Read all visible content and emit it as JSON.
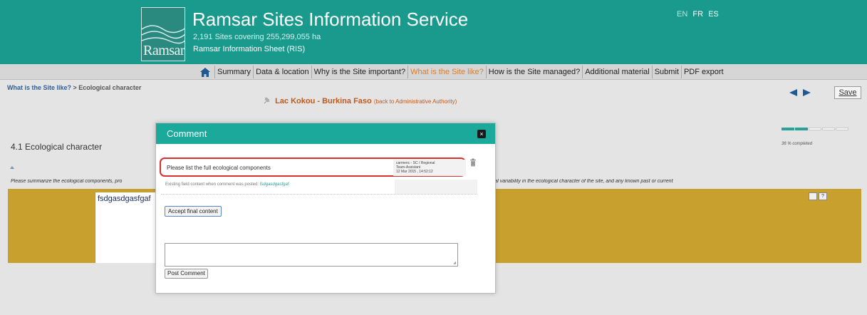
{
  "header": {
    "logo_text": "Ramsar",
    "title": "Ramsar Sites Information Service",
    "subtitle": "2,191 Sites covering 255,299,055 ha",
    "subtitle2": "Ramsar Information Sheet (RIS)",
    "languages": [
      "EN",
      "FR",
      "ES"
    ],
    "active_language": "EN"
  },
  "nav": {
    "home_icon": "home-icon",
    "items": [
      {
        "label": "Summary"
      },
      {
        "label": "Data & location"
      },
      {
        "label": "Why is the Site important?"
      },
      {
        "label": "What is the Site like?",
        "active": true
      },
      {
        "label": "How is the Site managed?"
      },
      {
        "label": "Additional material"
      },
      {
        "label": "Submit"
      },
      {
        "label": "PDF export"
      }
    ]
  },
  "breadcrumb": {
    "link": "What is the Site like?",
    "sep": " > ",
    "current": "Ecological character"
  },
  "site": {
    "name": "Lac Kokou - Burkina Faso",
    "back_link": "(back to Administrative Authority)"
  },
  "toolbar": {
    "save_label": "Save"
  },
  "progress": {
    "fraction": 0.36,
    "segments_total": 5,
    "segments_done": 2,
    "text": "36 % completed"
  },
  "section": {
    "title": "4.1 Ecological character",
    "instruction_left": "Please summarize the ecological components, pro",
    "instruction_right": "ral variability in the ecological character of the site, and any known past or current",
    "field_value": "fsdgasdgasfgaf",
    "tool_expand": "",
    "tool_help": "?"
  },
  "modal": {
    "title": "Comment",
    "close_label": "×",
    "comment_text": "Please list the full ecological components",
    "comment_author": "carmenc - SC / Regional",
    "comment_role": "Team-Assistant",
    "comment_date": "12 Mar 2015 , 14:52:12",
    "existing_label": "Existing field content when comment was posted:",
    "existing_value": "fsdgasdgasfgaf",
    "accept_label": "Accept final content",
    "new_comment_value": "",
    "post_label": "Post Comment"
  },
  "colors": {
    "header_teal": "#1a9a8c",
    "modal_teal": "#1aa99a",
    "field_gold": "#c8a02e",
    "active_nav": "#e27a25",
    "highlight_red": "#d9312f"
  }
}
